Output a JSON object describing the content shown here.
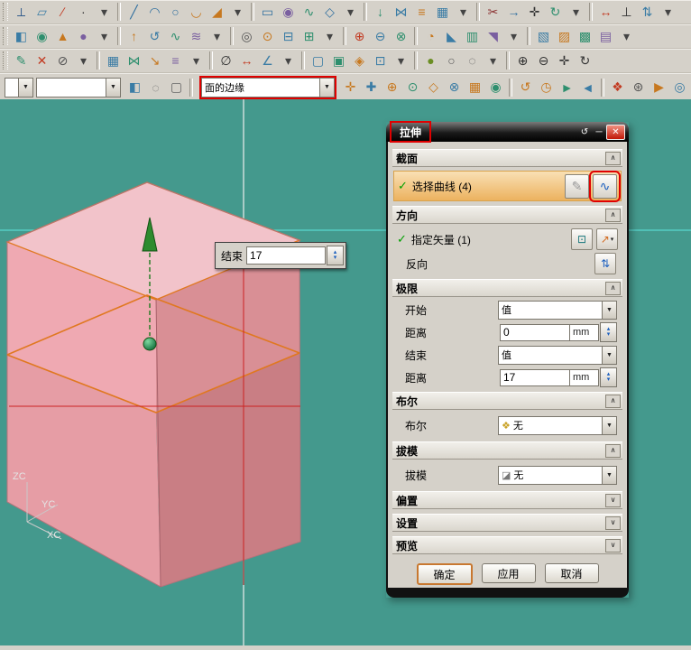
{
  "colors": {
    "viewport_bg": "#44998D",
    "annotation_red": "#E00000",
    "selection_highlight": "#ECB25F",
    "section_curve_orange": "#E07820",
    "box_top": "#F2C3CA",
    "box_left_new": "#EFA9B2",
    "box_left_old": "#E69DA5",
    "box_right_new": "#D98F95",
    "box_right_old": "#C97E84",
    "handle_green": "#2E8B2E",
    "crosshair_red": "#CC2222",
    "guide_cyan": "#58D8D0"
  },
  "icons": {
    "combo_arrow": "▼",
    "spin_up": "▴",
    "spin_down": "▾",
    "check": "✓",
    "chevron_up": "∧",
    "chevron_down": "∨",
    "sketch_section": "✎",
    "curve_rule": "∿",
    "vector_dialog": "⊡",
    "vector_menu": "↗",
    "reverse": "⇅",
    "bool_none": "❖",
    "draft_none": "◪",
    "reset": "↺",
    "minimize": "─",
    "close": "✕"
  },
  "toolbars": {
    "rows": [
      [
        {
          "name": "csys-icon",
          "glyph": "⟂",
          "color": "#335C8C"
        },
        {
          "name": "datum-plane-icon",
          "glyph": "▱",
          "color": "#3A7CA5"
        },
        {
          "name": "datum-axis-icon",
          "glyph": "∕",
          "color": "#C23B22"
        },
        {
          "name": "point-icon",
          "glyph": "∙",
          "color": "#333333"
        },
        {
          "name": "dropdown-arrow-icon",
          "glyph": "▾",
          "color": "#444444"
        },
        {
          "sep": true
        },
        {
          "name": "line-icon",
          "glyph": "╱",
          "color": "#2F6F9F"
        },
        {
          "name": "arc-icon",
          "glyph": "◠",
          "color": "#2F6F9F"
        },
        {
          "name": "circle-icon",
          "glyph": "○",
          "color": "#2F6F9F"
        },
        {
          "name": "fillet-icon",
          "glyph": "◡",
          "color": "#C7781F"
        },
        {
          "name": "chamfer-icon",
          "glyph": "◢",
          "color": "#C7781F"
        },
        {
          "name": "dropdown-arrow-icon",
          "glyph": "▾",
          "color": "#444444"
        },
        {
          "sep": true
        },
        {
          "name": "rect-icon",
          "glyph": "▭",
          "color": "#2F6F9F"
        },
        {
          "name": "ellipse-icon",
          "glyph": "◉",
          "color": "#7A5FA0"
        },
        {
          "name": "spline-icon",
          "glyph": "∿",
          "color": "#2E8F6E"
        },
        {
          "name": "polygon-icon",
          "glyph": "◇",
          "color": "#2F6F9F"
        },
        {
          "name": "dropdown-arrow-icon",
          "glyph": "▾",
          "color": "#444444"
        },
        {
          "sep": true
        },
        {
          "name": "project-curve-icon",
          "glyph": "↓",
          "color": "#2E8F6E"
        },
        {
          "name": "mirror-curve-icon",
          "glyph": "⋈",
          "color": "#3A7CA5"
        },
        {
          "name": "offset-curve-icon",
          "glyph": "≡",
          "color": "#C7781F"
        },
        {
          "name": "pattern-curve-icon",
          "glyph": "▦",
          "color": "#3A7CA5"
        },
        {
          "name": "dropdown-arrow-icon",
          "glyph": "▾",
          "color": "#444444"
        },
        {
          "sep": true
        },
        {
          "name": "trim-icon",
          "glyph": "✂",
          "color": "#8A2F2F"
        },
        {
          "name": "extend-icon",
          "glyph": "→",
          "color": "#2F6F9F"
        },
        {
          "name": "move-icon",
          "glyph": "✛",
          "color": "#333333"
        },
        {
          "name": "rotate-icon",
          "glyph": "↻",
          "color": "#2E8F6E"
        },
        {
          "name": "dropdown-arrow-icon",
          "glyph": "▾",
          "color": "#444444"
        },
        {
          "sep": true
        },
        {
          "name": "measure-icon",
          "glyph": "↔",
          "color": "#C23B22"
        },
        {
          "name": "constraint-icon",
          "glyph": "⊥",
          "color": "#333333"
        },
        {
          "name": "dimension-icon",
          "glyph": "⇅",
          "color": "#3A7CA5"
        },
        {
          "name": "dropdown-arrow-icon",
          "glyph": "▾",
          "color": "#444444"
        }
      ],
      [
        {
          "name": "cube-icon",
          "glyph": "◧",
          "color": "#3A7CA5"
        },
        {
          "name": "cylinder-icon",
          "glyph": "◉",
          "color": "#2E8F6E"
        },
        {
          "name": "cone-icon",
          "glyph": "▲",
          "color": "#C7781F"
        },
        {
          "name": "sphere-icon",
          "glyph": "●",
          "color": "#7A5FA0"
        },
        {
          "name": "dropdown-arrow-icon",
          "glyph": "▾",
          "color": "#444444"
        },
        {
          "sep": true
        },
        {
          "name": "extrude-icon",
          "glyph": "↑",
          "color": "#C7781F"
        },
        {
          "name": "revolve-icon",
          "glyph": "↺",
          "color": "#3A7CA5"
        },
        {
          "name": "sweep-icon",
          "glyph": "∿",
          "color": "#2E8F6E"
        },
        {
          "name": "loft-icon",
          "glyph": "≋",
          "color": "#7A5FA0"
        },
        {
          "name": "dropdown-arrow-icon",
          "glyph": "▾",
          "color": "#444444"
        },
        {
          "sep": true
        },
        {
          "name": "hole-icon",
          "glyph": "◎",
          "color": "#555555"
        },
        {
          "name": "boss-icon",
          "glyph": "⊙",
          "color": "#C7781F"
        },
        {
          "name": "pocket-icon",
          "glyph": "⊟",
          "color": "#3A7CA5"
        },
        {
          "name": "pad-icon",
          "glyph": "⊞",
          "color": "#2E8F6E"
        },
        {
          "name": "dropdown-arrow-icon",
          "glyph": "▾",
          "color": "#444444"
        },
        {
          "sep": true
        },
        {
          "name": "unite-icon",
          "glyph": "⊕",
          "color": "#C23B22"
        },
        {
          "name": "subtract-icon",
          "glyph": "⊖",
          "color": "#3A7CA5"
        },
        {
          "name": "intersect-icon",
          "glyph": "⊗",
          "color": "#2E8F6E"
        },
        {
          "sep": true
        },
        {
          "name": "edge-blend-icon",
          "glyph": "◔",
          "color": "#C7781F"
        },
        {
          "name": "edge-chamfer-icon",
          "glyph": "◣",
          "color": "#3A7CA5"
        },
        {
          "name": "shell-icon",
          "glyph": "▥",
          "color": "#2E8F6E"
        },
        {
          "name": "taper-icon",
          "glyph": "◥",
          "color": "#7A5FA0"
        },
        {
          "name": "dropdown-arrow-icon",
          "glyph": "▾",
          "color": "#444444"
        },
        {
          "sep": true
        },
        {
          "name": "trim-body-icon",
          "glyph": "▧",
          "color": "#3A7CA5"
        },
        {
          "name": "split-body-icon",
          "glyph": "▨",
          "color": "#C7781F"
        },
        {
          "name": "patch-icon",
          "glyph": "▩",
          "color": "#2E8F6E"
        },
        {
          "name": "sew-icon",
          "glyph": "▤",
          "color": "#7A5FA0"
        },
        {
          "name": "dropdown-arrow-icon",
          "glyph": "▾",
          "color": "#444444"
        }
      ],
      [
        {
          "name": "edit-feature-icon",
          "glyph": "✎",
          "color": "#2E8F6E"
        },
        {
          "name": "delete-icon",
          "glyph": "✕",
          "color": "#C23B22"
        },
        {
          "name": "suppress-icon",
          "glyph": "⊘",
          "color": "#555555"
        },
        {
          "name": "dropdown-arrow-icon",
          "glyph": "▾",
          "color": "#444444"
        },
        {
          "sep": true
        },
        {
          "name": "pattern-feature-icon",
          "glyph": "▦",
          "color": "#3A7CA5"
        },
        {
          "name": "mirror-feature-icon",
          "glyph": "⋈",
          "color": "#2E8F6E"
        },
        {
          "name": "scale-body-icon",
          "glyph": "↘",
          "color": "#C7781F"
        },
        {
          "name": "offset-face-icon",
          "glyph": "≡",
          "color": "#7A5FA0"
        },
        {
          "name": "dropdown-arrow-icon",
          "glyph": "▾",
          "color": "#444444"
        },
        {
          "sep": true
        },
        {
          "name": "diameter-icon",
          "glyph": "∅",
          "color": "#333333"
        },
        {
          "name": "distance-icon",
          "glyph": "↔",
          "color": "#C23B22"
        },
        {
          "name": "angle-icon",
          "glyph": "∠",
          "color": "#3A7CA5"
        },
        {
          "name": "dropdown-arrow-icon",
          "glyph": "▾",
          "color": "#444444"
        },
        {
          "sep": true
        },
        {
          "name": "view-front-icon",
          "glyph": "▢",
          "color": "#3A7CA5"
        },
        {
          "name": "view-top-icon",
          "glyph": "▣",
          "color": "#2E8F6E"
        },
        {
          "name": "view-iso-icon",
          "glyph": "◈",
          "color": "#C7781F"
        },
        {
          "name": "fit-view-icon",
          "glyph": "⊡",
          "color": "#3A7CA5"
        },
        {
          "name": "dropdown-arrow-icon",
          "glyph": "▾",
          "color": "#444444"
        },
        {
          "sep": true
        },
        {
          "name": "shaded-icon",
          "glyph": "●",
          "color": "#6B8E23"
        },
        {
          "name": "wireframe-icon",
          "glyph": "○",
          "color": "#555555"
        },
        {
          "name": "hidden-line-icon",
          "glyph": "◌",
          "color": "#555555"
        },
        {
          "name": "dropdown-arrow-icon",
          "glyph": "▾",
          "color": "#444444"
        },
        {
          "sep": true
        },
        {
          "name": "zoom-in-icon",
          "glyph": "⊕",
          "color": "#333333"
        },
        {
          "name": "zoom-out-icon",
          "glyph": "⊖",
          "color": "#333333"
        },
        {
          "name": "pan-icon",
          "glyph": "✛",
          "color": "#333333"
        },
        {
          "name": "orbit-icon",
          "glyph": "↻",
          "color": "#333333"
        }
      ]
    ],
    "row4": {
      "small_combo_value": "",
      "mid_combo_value": "",
      "left_icons": [
        {
          "name": "solid-face-icon",
          "glyph": "◧",
          "color": "#3A7CA5"
        },
        {
          "name": "dashed-circle-icon",
          "glyph": "◌",
          "color": "#666666"
        },
        {
          "name": "dashed-rect-icon",
          "glyph": "▢",
          "color": "#666666"
        },
        {
          "sep": true
        }
      ],
      "filter_combo_value": "面的边缘",
      "right_icons": [
        {
          "name": "snap-point-icon",
          "glyph": "✛",
          "color": "#C7781F"
        },
        {
          "name": "snap-endpoint-icon",
          "glyph": "✚",
          "color": "#3A7CA5"
        },
        {
          "name": "snap-midpoint-icon",
          "glyph": "⊕",
          "color": "#C7781F"
        },
        {
          "name": "snap-center-icon",
          "glyph": "⊙",
          "color": "#2E8F6E"
        },
        {
          "name": "snap-quadrant-icon",
          "glyph": "◇",
          "color": "#C7781F"
        },
        {
          "name": "snap-intersection-icon",
          "glyph": "⊗",
          "color": "#3A7CA5"
        },
        {
          "name": "grid-snap-icon",
          "glyph": "▦",
          "color": "#C7781F"
        },
        {
          "name": "snap-node-icon",
          "glyph": "◉",
          "color": "#2E8F6E"
        },
        {
          "sep": true
        },
        {
          "name": "history-icon",
          "glyph": "↺",
          "color": "#C7781F"
        },
        {
          "name": "clock-icon",
          "glyph": "◷",
          "color": "#C7781F"
        },
        {
          "name": "forward-icon",
          "glyph": "►",
          "color": "#2E8F6E"
        },
        {
          "name": "back-icon",
          "glyph": "◄",
          "color": "#3A7CA5"
        },
        {
          "sep": true
        },
        {
          "name": "palette-icon",
          "glyph": "❖",
          "color": "#C23B22"
        },
        {
          "name": "gear-icon",
          "glyph": "⊛",
          "color": "#555555"
        },
        {
          "name": "flag-icon",
          "glyph": "▶",
          "color": "#C7781F"
        },
        {
          "name": "target-icon",
          "glyph": "◎",
          "color": "#3A7CA5"
        }
      ]
    }
  },
  "viewport": {
    "float_input": {
      "label": "结束",
      "value": "17"
    },
    "axis_labels": {
      "z": "ZC",
      "y": "YC",
      "x": "XC"
    }
  },
  "dialog": {
    "title": "拉伸",
    "section": {
      "header": "截面",
      "select_label": "选择曲线 (4)"
    },
    "direction": {
      "header": "方向",
      "vector_label": "指定矢量 (1)",
      "reverse_label": "反向"
    },
    "limits": {
      "header": "极限",
      "start_label": "开始",
      "start_value": "值",
      "start_dist_label": "距离",
      "start_dist_value": "0",
      "start_unit": "mm",
      "end_label": "结束",
      "end_value": "值",
      "end_dist_label": "距离",
      "end_dist_value": "17",
      "end_unit": "mm"
    },
    "boolean": {
      "header": "布尔",
      "label": "布尔",
      "value": "无"
    },
    "draft": {
      "header": "拔模",
      "label": "拔模",
      "value": "无"
    },
    "offset_header": "偏置",
    "settings_header": "设置",
    "preview_header": "预览",
    "buttons": {
      "ok": "确定",
      "apply": "应用",
      "cancel": "取消"
    }
  }
}
